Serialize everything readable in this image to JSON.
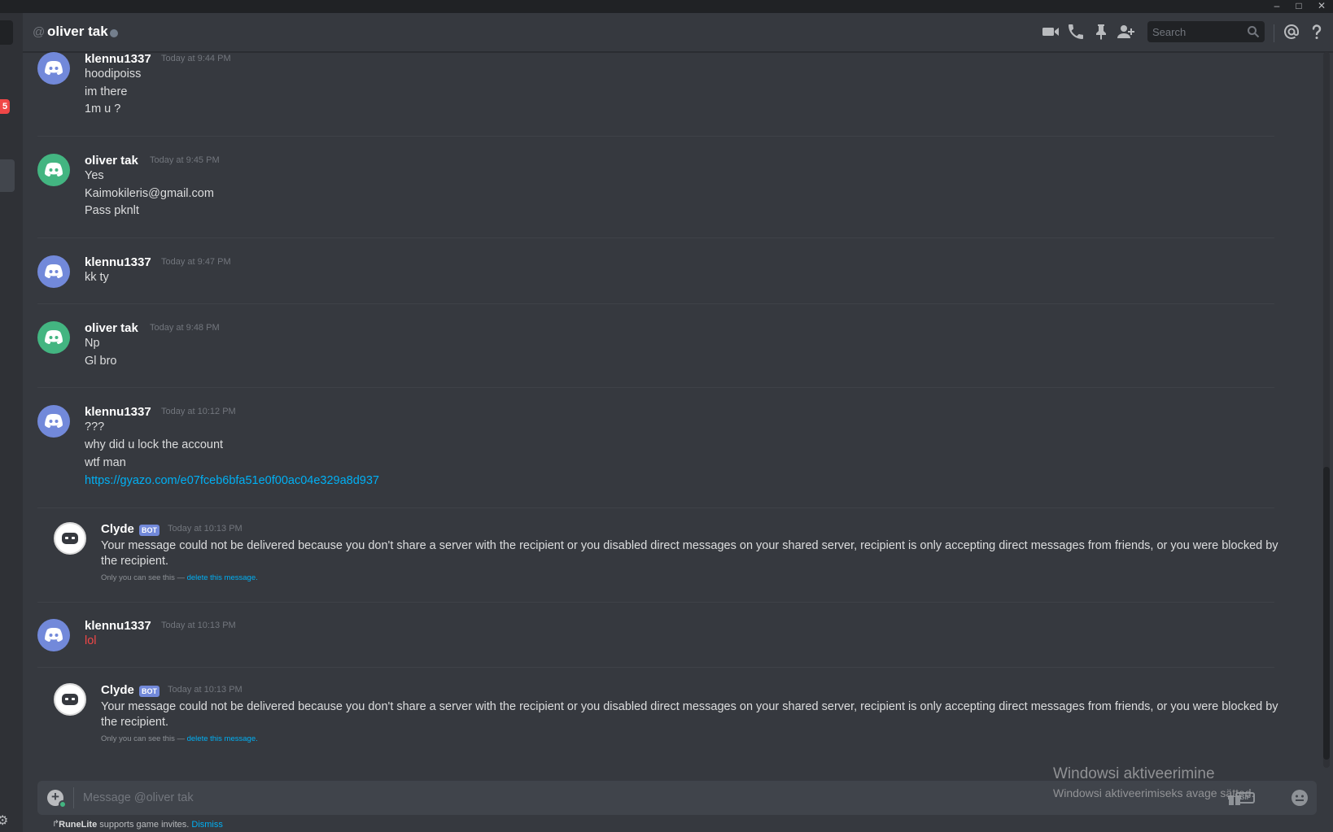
{
  "window": {
    "minimize_glyph": "–",
    "maximize_glyph": "□",
    "close_glyph": "✕"
  },
  "sidebar": {
    "badge": "5"
  },
  "header": {
    "at_symbol": "@",
    "title": "oliver tak",
    "status": "offline",
    "search_placeholder": "Search",
    "icons": [
      "video-call-icon",
      "voice-call-icon",
      "pin-icon",
      "add-friend-icon",
      "mentions-icon",
      "help-icon"
    ]
  },
  "messages": [
    {
      "author": "klennu1337",
      "timestamp": "Today at 9:44 PM",
      "avatar_color": "#7289da",
      "lines": [
        "hoodipoiss",
        "im there",
        "1m u ?"
      ]
    },
    {
      "author": "oliver tak",
      "timestamp": "Today at 9:45 PM",
      "avatar_color": "#43b581",
      "lines": [
        "Yes",
        "Kaimokileris@gmail.com",
        "Pass pknlt"
      ]
    },
    {
      "author": "klennu1337",
      "timestamp": "Today at 9:47 PM",
      "avatar_color": "#7289da",
      "lines": [
        "kk ty"
      ]
    },
    {
      "author": "oliver tak",
      "timestamp": "Today at 9:48 PM",
      "avatar_color": "#43b581",
      "lines": [
        "Np",
        "Gl bro"
      ]
    },
    {
      "author": "klennu1337",
      "timestamp": "Today at 10:12 PM",
      "avatar_color": "#7289da",
      "lines": [
        "???",
        "why did u lock the account",
        "wtf man"
      ],
      "link": "https://gyazo.com/e07fceb6bfa51e0f00ac04e329a8d937"
    },
    {
      "author": "Clyde",
      "bot_tag": "BOT",
      "timestamp": "Today at 10:13 PM",
      "text": "Your message could not be delivered because you don't share a server with the recipient or you disabled direct messages on your shared server, recipient is only accepting direct messages from friends, or you were blocked by the recipient.",
      "note_prefix": "Only you can see this —",
      "note_link": "delete this message."
    },
    {
      "author": "klennu1337",
      "timestamp": "Today at 10:13 PM",
      "avatar_color": "#7289da",
      "lines": [
        "lol"
      ]
    },
    {
      "author": "Clyde",
      "bot_tag": "BOT",
      "timestamp": "Today at 10:13 PM",
      "text": "Your message could not be delivered because you don't share a server with the recipient or you disabled direct messages on your shared server, recipient is only accepting direct messages from friends, or you were blocked by the recipient.",
      "note_prefix": "Only you can see this —",
      "note_link": "delete this message."
    }
  ],
  "composer": {
    "placeholder": "Message @oliver tak",
    "gif_label": "GIF"
  },
  "watermark": {
    "line1": "Windowsi aktiveerimine",
    "line2": "Windowsi aktiveerimiseks avage sätted."
  },
  "footer": {
    "app_name": "RuneLite",
    "text": "supports game invites.",
    "dismiss": "Dismiss"
  },
  "colors": {
    "background": "#36393f",
    "accent": "#7289da",
    "link": "#00b0f4",
    "danger": "#f04747"
  }
}
